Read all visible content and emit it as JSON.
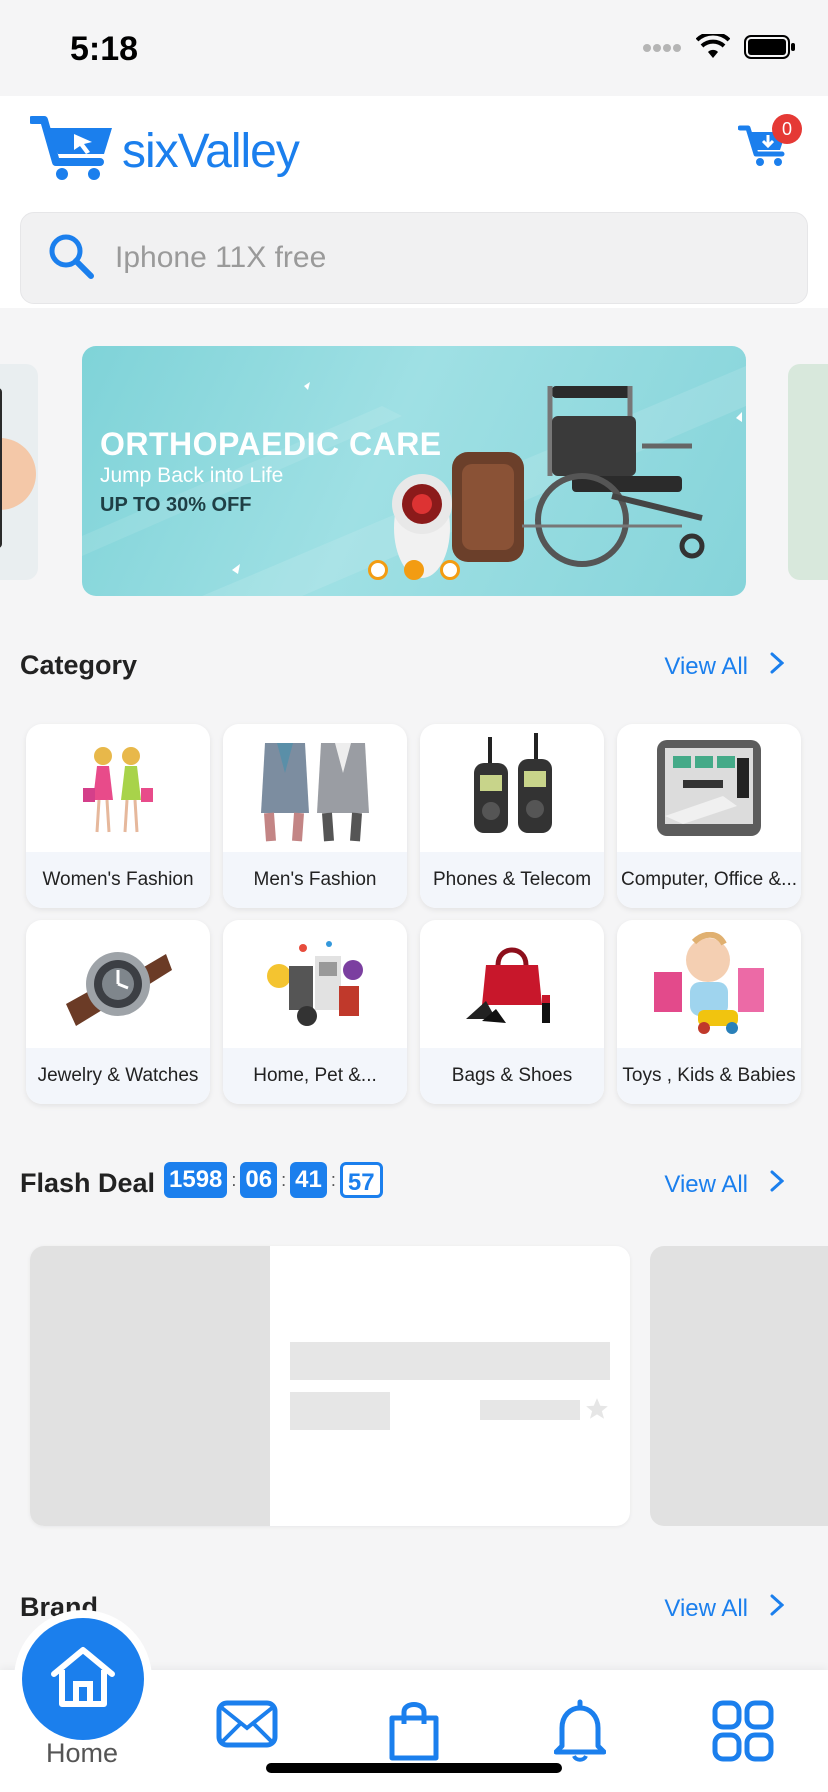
{
  "status": {
    "time": "5:18"
  },
  "header": {
    "logo_text": "sixValley",
    "cart_count": "0"
  },
  "search": {
    "placeholder": "Iphone 11X free"
  },
  "banner": {
    "title": "ORTHOPAEDIC CARE",
    "subtitle": "Jump Back into Life",
    "offer": "UP TO 30% OFF",
    "active_dot": 1,
    "dots": 3
  },
  "category": {
    "title": "Category",
    "view_all": "View All",
    "items": [
      {
        "label": "Women's Fashion"
      },
      {
        "label": "Men's Fashion"
      },
      {
        "label": "Phones & Telecom"
      },
      {
        "label": "Computer, Office &..."
      },
      {
        "label": "Jewelry & Watches"
      },
      {
        "label": "Home, Pet &..."
      },
      {
        "label": "Bags & Shoes"
      },
      {
        "label": "Toys , Kids & Babies"
      }
    ]
  },
  "flash_deal": {
    "title": "Flash Deal",
    "view_all": "View All",
    "timer": {
      "days": "1598",
      "hours": "06",
      "minutes": "41",
      "seconds": "57"
    }
  },
  "brand": {
    "title": "Brand",
    "view_all": "View All"
  },
  "bottom_nav": {
    "home_label": "Home"
  },
  "colors": {
    "accent": "#1b7fed",
    "badge": "#e53935",
    "dot": "#f39c12"
  }
}
